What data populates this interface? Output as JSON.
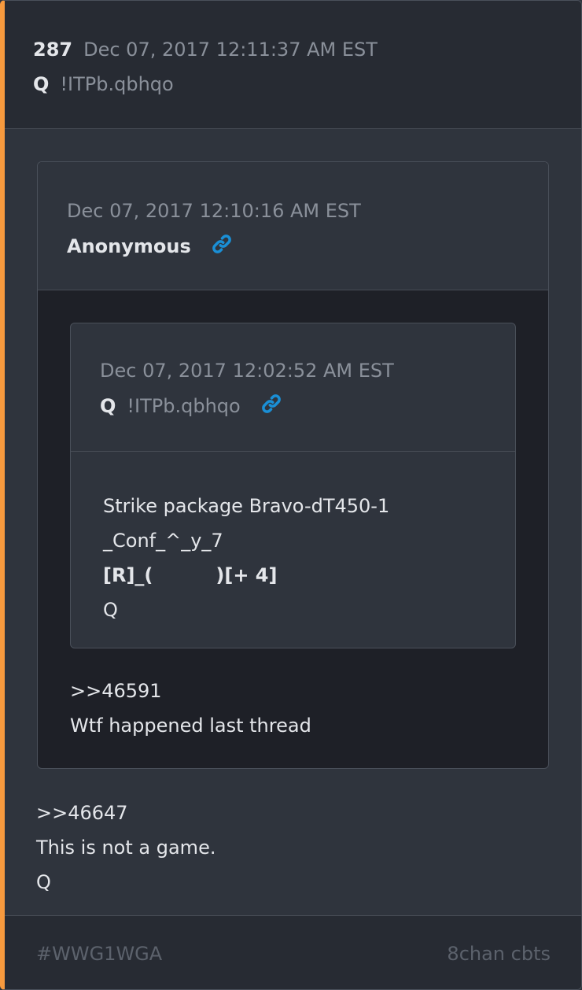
{
  "post": {
    "number": "287",
    "date": "Dec 07, 2017 12:11:37 AM EST",
    "name": "Q",
    "tripcode": "!ITPb.qbhqo",
    "body": [
      ">>46647",
      "This is not a game.",
      "Q"
    ]
  },
  "quoted_post": {
    "date": "Dec 07, 2017 12:10:16 AM EST",
    "name": "Anonymous",
    "link_icon": "link-icon",
    "body": [
      ">>46591",
      "Wtf happened last thread"
    ]
  },
  "nested_quote": {
    "date": "Dec 07, 2017 12:02:52 AM EST",
    "name": "Q",
    "tripcode": "!ITPb.qbhqo",
    "link_icon": "link-icon",
    "body_line1": "Strike package Bravo-dT450-1",
    "body_line2": "_Conf_^_y_7",
    "body_line3_a": "[R]_(",
    "body_line3_b": ")[+ 4]",
    "body_line4": "Q"
  },
  "footer": {
    "hashtag": "#WWG1WGA",
    "source": "8chan cbts"
  },
  "colors": {
    "accent_border": "#f79a3e",
    "link_icon": "#1a8fd6",
    "background": "#2f343d",
    "header_background": "#272b33",
    "quote_background": "#1e2027"
  }
}
